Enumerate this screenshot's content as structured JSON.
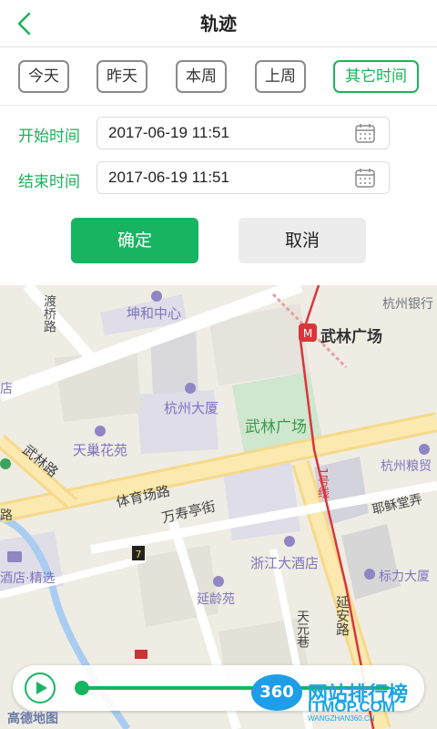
{
  "header": {
    "title": "轨迹"
  },
  "tabs": [
    {
      "label": "今天"
    },
    {
      "label": "昨天"
    },
    {
      "label": "本周"
    },
    {
      "label": "上周"
    },
    {
      "label": "其它时间",
      "active": true
    }
  ],
  "form": {
    "start_label": "开始时间",
    "start_value": "2017-06-19 11:51",
    "end_label": "结束时间",
    "end_value": "2017-06-19 11:51",
    "confirm_label": "确定",
    "cancel_label": "取消"
  },
  "map": {
    "pois": [
      "坤和中心",
      "杭州银行",
      "武林广场",
      "杭州大厦",
      "武林广场",
      "天巢花苑",
      "杭州粮贸",
      "浙江大酒店",
      "标力大厦",
      "延龄苑",
      "酒店·精选"
    ],
    "roads": [
      "渡桥路",
      "体育场路",
      "万寿亭街",
      "武林路",
      "耶稣堂弄",
      "延安路",
      "天元巷",
      "1号线",
      "店",
      "路"
    ],
    "logo": "高德地图"
  },
  "watermark": {
    "badge": "360",
    "name": "网站排行榜",
    "domain": "ITMOP.COM",
    "url": "WANGZHAN360.CN"
  },
  "colors": {
    "accent": "#19b35a",
    "button": "#17b462",
    "metro": "#d9353b"
  }
}
